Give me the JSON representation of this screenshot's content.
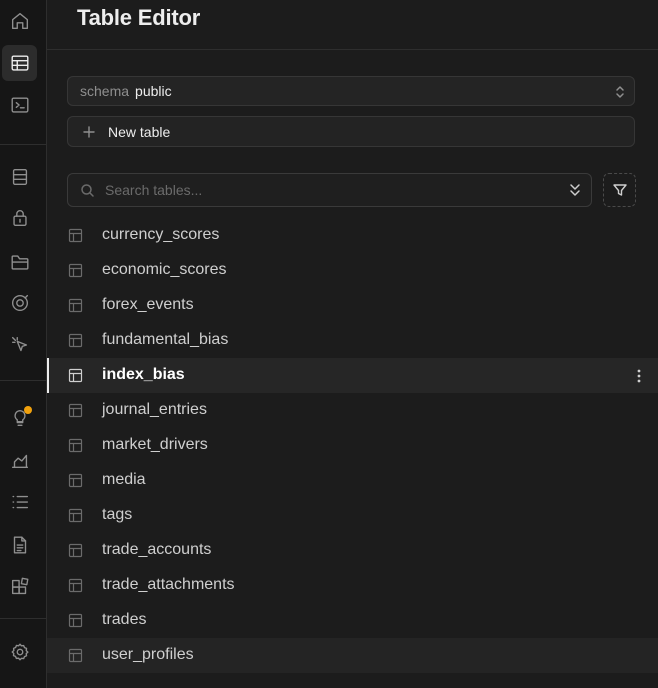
{
  "header": {
    "title": "Table Editor"
  },
  "schema": {
    "label": "schema",
    "value": "public"
  },
  "new_table": {
    "label": "New table"
  },
  "search": {
    "placeholder": "Search tables..."
  },
  "tables": [
    {
      "name": "currency_scores"
    },
    {
      "name": "economic_scores"
    },
    {
      "name": "forex_events"
    },
    {
      "name": "fundamental_bias"
    },
    {
      "name": "index_bias",
      "selected": true
    },
    {
      "name": "journal_entries"
    },
    {
      "name": "market_drivers"
    },
    {
      "name": "media"
    },
    {
      "name": "tags"
    },
    {
      "name": "trade_accounts"
    },
    {
      "name": "trade_attachments"
    },
    {
      "name": "trades"
    },
    {
      "name": "user_profiles",
      "hovered": true
    }
  ],
  "rail": {
    "icons": [
      "home-icon",
      "table-editor-icon",
      "sql-editor-icon",
      "database-icon",
      "auth-icon",
      "storage-icon",
      "realtime-icon",
      "edge-functions-icon",
      "advisors-icon",
      "reports-icon",
      "logs-icon",
      "api-docs-icon",
      "integrations-icon",
      "settings-icon"
    ]
  },
  "colors": {
    "notification_dot": "#f1a10d",
    "background": "#1c1c1c"
  }
}
